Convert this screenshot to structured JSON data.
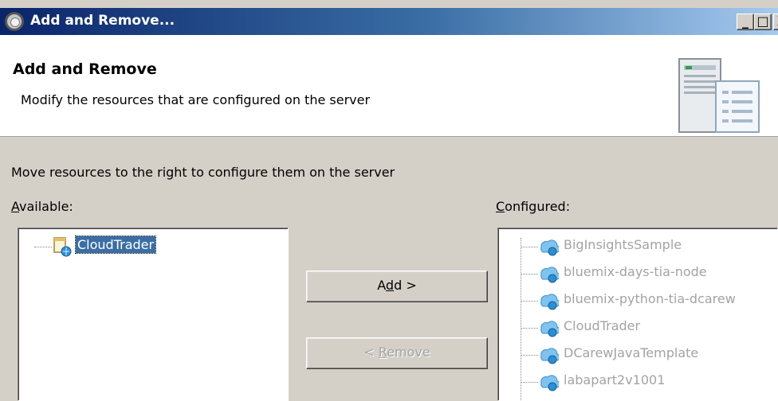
{
  "window": {
    "title": "Add and Remove...",
    "controls": {
      "minimize": "_",
      "maximize": "□",
      "close": "X"
    }
  },
  "header": {
    "title": "Add and Remove",
    "description": "Modify the resources that are configured on the server"
  },
  "body": {
    "instruction": "Move resources to the right to configure them on the server",
    "available_label_mnemonic": "A",
    "available_label_rest": "vailable:",
    "configured_label_mnemonic": "C",
    "configured_label_rest": "onfigured:"
  },
  "available": {
    "items": [
      {
        "label": "CloudTrader",
        "selected": true
      }
    ]
  },
  "configured": {
    "items": [
      {
        "label": "BigInsightsSample"
      },
      {
        "label": "bluemix-days-tia-node"
      },
      {
        "label": "bluemix-python-tia-dcarew"
      },
      {
        "label": "CloudTrader"
      },
      {
        "label": "DCarewJavaTemplate"
      },
      {
        "label": "labapart2v1001"
      }
    ]
  },
  "buttons": {
    "add_pre": "A",
    "add_mnemonic": "d",
    "add_post": "d >",
    "remove_pre": "< ",
    "remove_mnemonic": "R",
    "remove_post": "emove"
  }
}
